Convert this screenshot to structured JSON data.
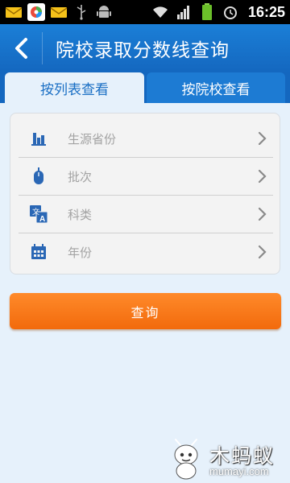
{
  "status_bar": {
    "time": "16:25",
    "icons": [
      "mail-icon",
      "app-icon",
      "mail-icon",
      "usb-icon",
      "android-icon",
      "wifi-icon",
      "signal-icon",
      "battery-icon",
      "alarm-icon"
    ]
  },
  "header": {
    "title": "院校录取分数线查询",
    "back_icon": "back-arrow-icon"
  },
  "tabs": [
    {
      "label": "按列表查看",
      "active": true
    },
    {
      "label": "按院校查看",
      "active": false
    }
  ],
  "form": {
    "rows": [
      {
        "label": "生源省份",
        "icon": "city-icon"
      },
      {
        "label": "批次",
        "icon": "mouse-icon"
      },
      {
        "label": "科类",
        "icon": "translate-icon"
      },
      {
        "label": "年份",
        "icon": "calendar-icon"
      }
    ]
  },
  "query_button": {
    "label": "查询"
  },
  "watermark": {
    "logo": "木蚂蚁",
    "site": "mumayi.com"
  },
  "colors": {
    "header": "#1467bf",
    "accent_orange": "#f26a0c",
    "background": "#e6f1fb",
    "icon_blue": "#2a67b5"
  }
}
